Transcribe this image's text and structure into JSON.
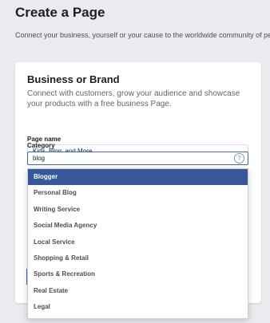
{
  "header": {
    "title": "Create a Page",
    "subtitle": "Connect your business, yourself or your cause to the worldwide community of pe"
  },
  "card": {
    "title": "Business or Brand",
    "description": "Connect with customers, grow your audience and showcase your products with a free business Page.",
    "page_name_label": "Page name",
    "page_name_value": "Kids, Blog, and More",
    "category_label": "Category",
    "category_value": "blog",
    "help_icon": "?"
  },
  "dropdown": {
    "selected_index": 0,
    "items": [
      "Blogger",
      "Personal Blog",
      "Writing Service",
      "Social Media Agency",
      "Local Service",
      "Shopping & Retail",
      "Sports & Recreation",
      "Real Estate",
      "Legal"
    ]
  },
  "colors": {
    "accent": "#365899",
    "background": "#e9ebee"
  }
}
